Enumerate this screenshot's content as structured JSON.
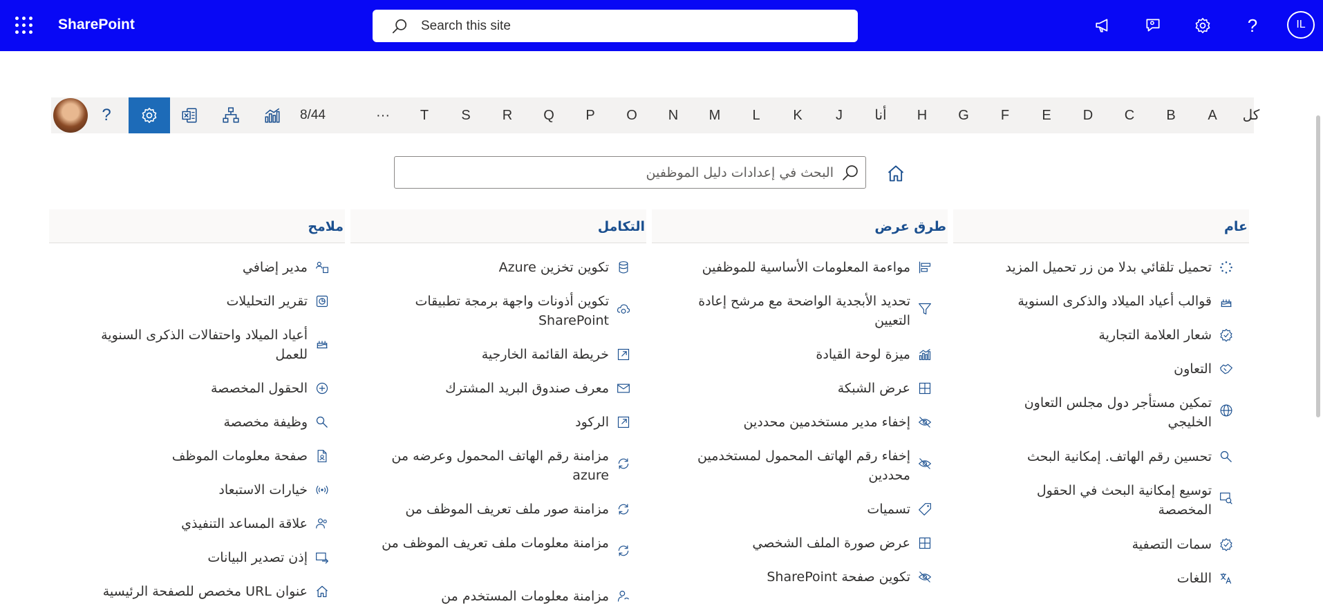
{
  "suitebar": {
    "brand": "SharePoint",
    "search_placeholder": "Search this site",
    "user_initials": "IL",
    "bg_color": "#0808f5"
  },
  "letterbar": {
    "letters": [
      "كل",
      "A",
      "B",
      "C",
      "D",
      "E",
      "F",
      "G",
      "H",
      "أنا",
      "J",
      "K",
      "L",
      "M",
      "N",
      "O",
      "P",
      "Q",
      "R",
      "S",
      "T",
      "···"
    ],
    "count": "8/44",
    "help": "?"
  },
  "settings_search": {
    "placeholder": "البحث في إعدادات دليل الموظفين"
  },
  "columns": [
    {
      "title": "عام",
      "items": [
        {
          "label": "تحميل تلقائي بدلا من زر تحميل المزيد",
          "icon": "loading-dots-icon"
        },
        {
          "label": "قوالب أعياد الميلاد والذكرى السنوية",
          "icon": "cake-icon"
        },
        {
          "label": "شعار العلامة التجارية",
          "icon": "badge-icon"
        },
        {
          "label": "التعاون",
          "icon": "handshake-icon"
        },
        {
          "label": "تمكين مستأجر دول مجلس التعاون الخليجي",
          "icon": "globe-icon"
        },
        {
          "label": "تحسين رقم الهاتف. إمكانية البحث",
          "icon": "search-key-icon"
        },
        {
          "label": "توسيع إمكانية البحث في الحقول المخصصة",
          "icon": "search-expand-icon"
        },
        {
          "label": "سمات التصفية",
          "icon": "badge-icon"
        },
        {
          "label": "اللغات",
          "icon": "translate-icon"
        }
      ]
    },
    {
      "title": "طرق عرض",
      "items": [
        {
          "label": "مواءمة المعلومات الأساسية للموظفين",
          "icon": "align-icon"
        },
        {
          "label": "تحديد الأبجدية الواضحة مع مرشح إعادة التعيين",
          "icon": "filter-icon"
        },
        {
          "label": "ميزة لوحة القيادة",
          "icon": "chart-icon"
        },
        {
          "label": "عرض الشبكة",
          "icon": "grid-icon"
        },
        {
          "label": "إخفاء مدير مستخدمين محددين",
          "icon": "eye-hide-icon"
        },
        {
          "label": "إخفاء رقم الهاتف المحمول لمستخدمين محددين",
          "icon": "eye-hide-icon"
        },
        {
          "label": "تسميات",
          "icon": "tag-icon"
        },
        {
          "label": "عرض صورة الملف الشخصي",
          "icon": "grid-icon"
        },
        {
          "label": "تكوين صفحة SharePoint",
          "icon": "eye-hide-icon"
        }
      ]
    },
    {
      "title": "التكامل",
      "items": [
        {
          "label": "تكوين تخزين Azure",
          "icon": "database-icon"
        },
        {
          "label": "تكوين أذونات واجهة برمجة تطبيقات SharePoint",
          "icon": "cloud-sync-icon"
        },
        {
          "label": "خريطة القائمة الخارجية",
          "icon": "external-list-icon"
        },
        {
          "label": "معرف صندوق البريد المشترك",
          "icon": "mail-icon"
        },
        {
          "label": "الركود",
          "icon": "external-list-icon"
        },
        {
          "label": "مزامنة رقم الهاتف المحمول وعرضه من azure",
          "icon": "sync-icon"
        },
        {
          "label": "مزامنة صور ملف تعريف الموظف من",
          "icon": "sync-icon"
        },
        {
          "label": "مزامنة معلومات ملف تعريف الموظف من",
          "icon": "sync-icon"
        },
        {
          "label": "مزامنة معلومات المستخدم من",
          "icon": "person-sync-icon"
        }
      ]
    },
    {
      "title": "ملامح",
      "items": [
        {
          "label": "مدير إضافي",
          "icon": "org-icon"
        },
        {
          "label": "تقرير التحليلات",
          "icon": "report-icon"
        },
        {
          "label": "أعياد الميلاد واحتفالات الذكرى السنوية للعمل",
          "icon": "cake-icon"
        },
        {
          "label": "الحقول المخصصة",
          "icon": "add-circle-icon"
        },
        {
          "label": "وظيفة مخصصة",
          "icon": "search-key-icon"
        },
        {
          "label": "صفحة معلومات الموظف",
          "icon": "document-person-icon"
        },
        {
          "label": "خيارات الاستبعاد",
          "icon": "broadcast-icon"
        },
        {
          "label": "علاقة المساعد التنفيذي",
          "icon": "people-icon"
        },
        {
          "label": "إذن تصدير البيانات",
          "icon": "export-icon"
        },
        {
          "label": "عنوان URL مخصص للصفحة الرئيسية",
          "icon": "home-icon"
        }
      ]
    }
  ]
}
